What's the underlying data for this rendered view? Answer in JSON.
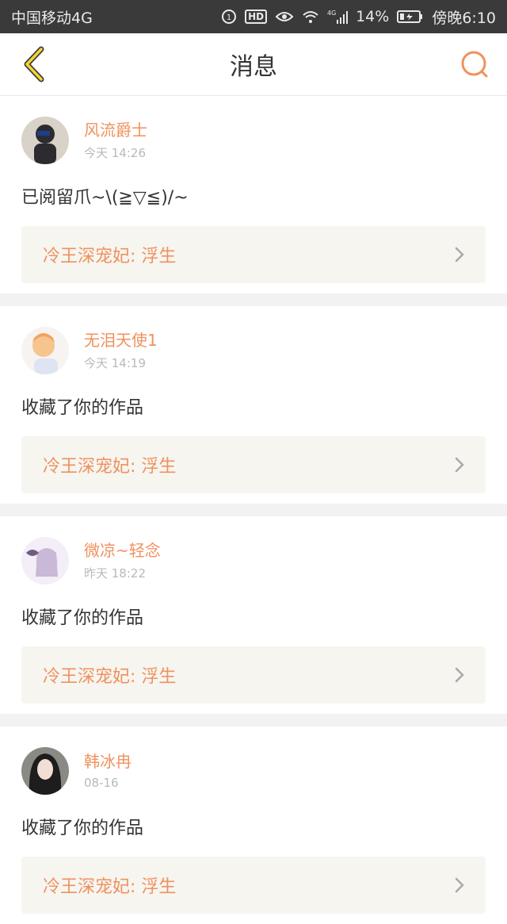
{
  "status": {
    "carrier": "中国移动4G",
    "signal_label": "4G",
    "battery": "14%",
    "time": "傍晚6:10"
  },
  "header": {
    "title": "消息"
  },
  "messages": [
    {
      "name": "风流爵士",
      "time": "今天 14:26",
      "text": "已阅留爪~\\(≧▽≦)/~",
      "work": "冷王深宠妃: 浮生",
      "avatar_color": "#2b2b30"
    },
    {
      "name": "无泪天使1",
      "time": "今天 14:19",
      "text": "收藏了你的作品",
      "work": "冷王深宠妃: 浮生",
      "avatar_color": "#f4b57b"
    },
    {
      "name": "微凉~轻念",
      "time": "昨天 18:22",
      "text": "收藏了你的作品",
      "work": "冷王深宠妃: 浮生",
      "avatar_color": "#c9b8d8"
    },
    {
      "name": "韩冰冉",
      "time": "08-16",
      "text": "收藏了你的作品",
      "work": "冷王深宠妃: 浮生",
      "avatar_color": "#1d1d1d"
    }
  ]
}
